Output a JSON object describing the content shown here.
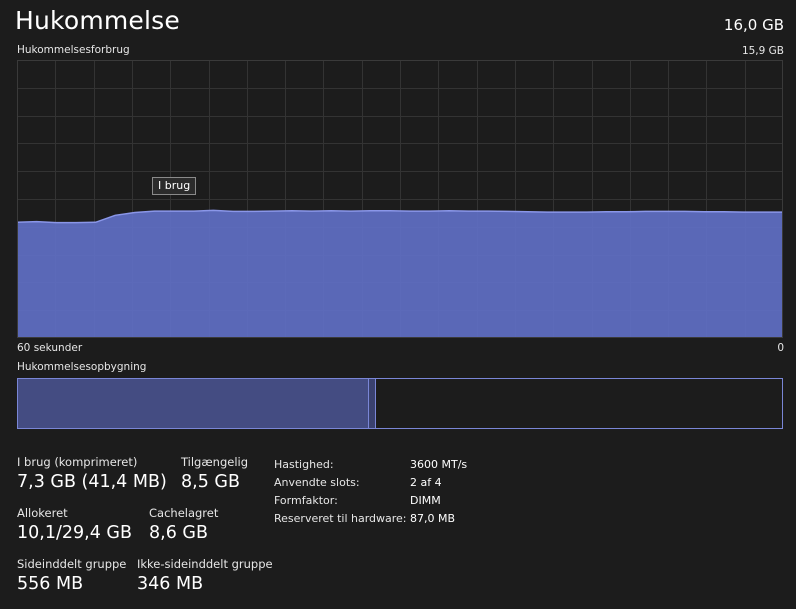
{
  "header": {
    "title": "Hukommelse",
    "total": "16,0 GB"
  },
  "usage_chart": {
    "label": "Hukommelsesforbrug",
    "max_label": "15,9 GB",
    "time_left_label": "60 sekunder",
    "time_right_label": "0",
    "tooltip": "I brug"
  },
  "chart_data": {
    "type": "area",
    "x_range": [
      60,
      0
    ],
    "ylim": [
      0,
      15.9
    ],
    "grid": true,
    "series": [
      {
        "name": "I brug",
        "values": [
          6.62,
          6.66,
          6.6,
          6.6,
          6.62,
          7.02,
          7.18,
          7.26,
          7.26,
          7.26,
          7.3,
          7.24,
          7.24,
          7.26,
          7.28,
          7.26,
          7.28,
          7.26,
          7.28,
          7.28,
          7.26,
          7.26,
          7.28,
          7.26,
          7.26,
          7.24,
          7.22,
          7.2,
          7.2,
          7.2,
          7.22,
          7.22,
          7.24,
          7.24,
          7.24,
          7.22,
          7.22,
          7.2,
          7.2,
          7.2
        ]
      }
    ],
    "colors": {
      "fill": "#5f6fc4",
      "line": "#8a96e8",
      "grid": "#333333"
    }
  },
  "composition": {
    "label": "Hukommelsesopbygning",
    "used_fraction": 0.458,
    "modified_fraction": 0.008
  },
  "stats": {
    "in_use": {
      "label": "I brug (komprimeret)",
      "value": "7,3 GB (41,4 MB)"
    },
    "available": {
      "label": "Tilgængelig",
      "value": "8,5 GB"
    },
    "committed": {
      "label": "Allokeret",
      "value": "10,1/29,4 GB"
    },
    "cached": {
      "label": "Cachelagret",
      "value": "8,6 GB"
    },
    "paged_pool": {
      "label": "Sideinddelt gruppe",
      "value": "556 MB"
    },
    "nonpaged_pool": {
      "label": "Ikke-sideinddelt gruppe",
      "value": "346 MB"
    }
  },
  "properties": [
    {
      "key": "Hastighed:",
      "value": "3600 MT/s"
    },
    {
      "key": "Anvendte slots:",
      "value": "2 af 4"
    },
    {
      "key": "Formfaktor:",
      "value": "DIMM"
    },
    {
      "key": "Reserveret til hardware:",
      "value": "87,0 MB"
    }
  ]
}
